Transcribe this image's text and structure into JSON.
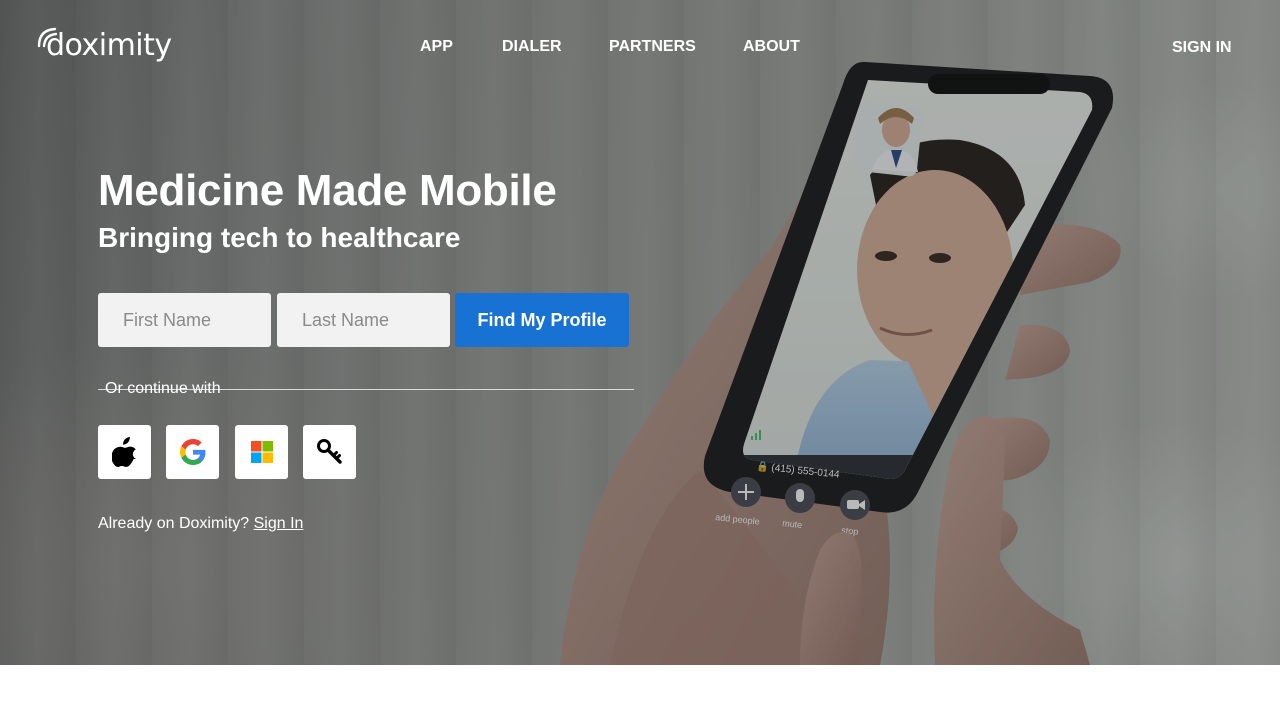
{
  "brand": {
    "name": "doximity",
    "accent": "#1872d4"
  },
  "nav": {
    "items": [
      "APP",
      "DIALER",
      "PARTNERS",
      "ABOUT"
    ],
    "sign_in": "SIGN IN"
  },
  "hero": {
    "headline": "Medicine Made Mobile",
    "subhead": "Bringing tech to healthcare",
    "form": {
      "first_name_placeholder": "First Name",
      "last_name_placeholder": "Last Name",
      "submit_label": "Find My Profile"
    },
    "divider_text": "Or continue with",
    "sso_icons": [
      "apple-icon",
      "google-icon",
      "microsoft-icon",
      "key-icon"
    ],
    "already_text": "Already on Doximity?",
    "already_link": "Sign In"
  },
  "phone": {
    "caller_number": "(415) 555-0144",
    "controls": [
      "add people",
      "mute",
      "stop"
    ]
  }
}
